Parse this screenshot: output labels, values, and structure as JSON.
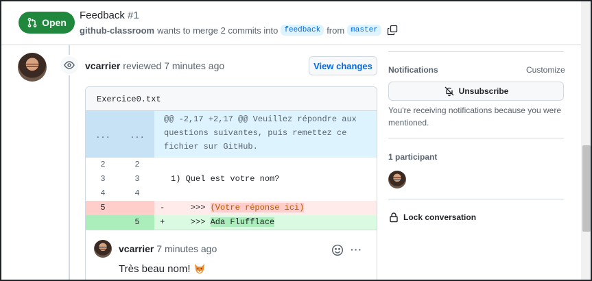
{
  "header": {
    "state_label": "Open",
    "title": "Feedback",
    "number": "#1",
    "author": "github-classroom",
    "merge_text": "wants to merge 2 commits into",
    "base_branch": "feedback",
    "from_text": "from",
    "head_branch": "master"
  },
  "review": {
    "author": "vcarrier",
    "action": "reviewed",
    "time": "7 minutes ago",
    "view_changes_label": "View changes"
  },
  "diff": {
    "filename": "Exercice0.txt",
    "hunk": {
      "left": "...",
      "right": "...",
      "lines": [
        "@@ -2,17 +2,17 @@ Veuillez répondre aux",
        " questions suivantes, puis remettez ce",
        " fichier sur GitHub."
      ]
    },
    "rows": [
      {
        "old": "2",
        "new": "2",
        "sign": "",
        "code": "",
        "kind": "ctx"
      },
      {
        "old": "3",
        "new": "3",
        "sign": "",
        "code": "1) Quel est votre nom?",
        "kind": "ctx"
      },
      {
        "old": "4",
        "new": "4",
        "sign": "",
        "code": "",
        "kind": "ctx"
      },
      {
        "old": "5",
        "new": "",
        "sign": "-",
        "prefix": "    >>> ",
        "highlight": "(Votre réponse ici)",
        "kind": "del"
      },
      {
        "old": "",
        "new": "5",
        "sign": "+",
        "prefix": "    >>> ",
        "highlight": "Ada Flufflace",
        "kind": "add"
      }
    ]
  },
  "comment": {
    "author": "vcarrier",
    "time": "7 minutes ago",
    "body": "Très beau nom!",
    "more_label": "···"
  },
  "sidebar": {
    "notifications_label": "Notifications",
    "customize_label": "Customize",
    "unsubscribe_label": "Unsubscribe",
    "notification_note": "You're receiving notifications because you were mentioned.",
    "participants_label": "1 participant",
    "lock_label": "Lock conversation"
  },
  "colors": {
    "open_green": "#1f883d",
    "link_blue": "#0969da",
    "deletion_bg": "#ffebe9",
    "addition_bg": "#dafbe1",
    "hunk_bg": "#ddf4ff"
  }
}
